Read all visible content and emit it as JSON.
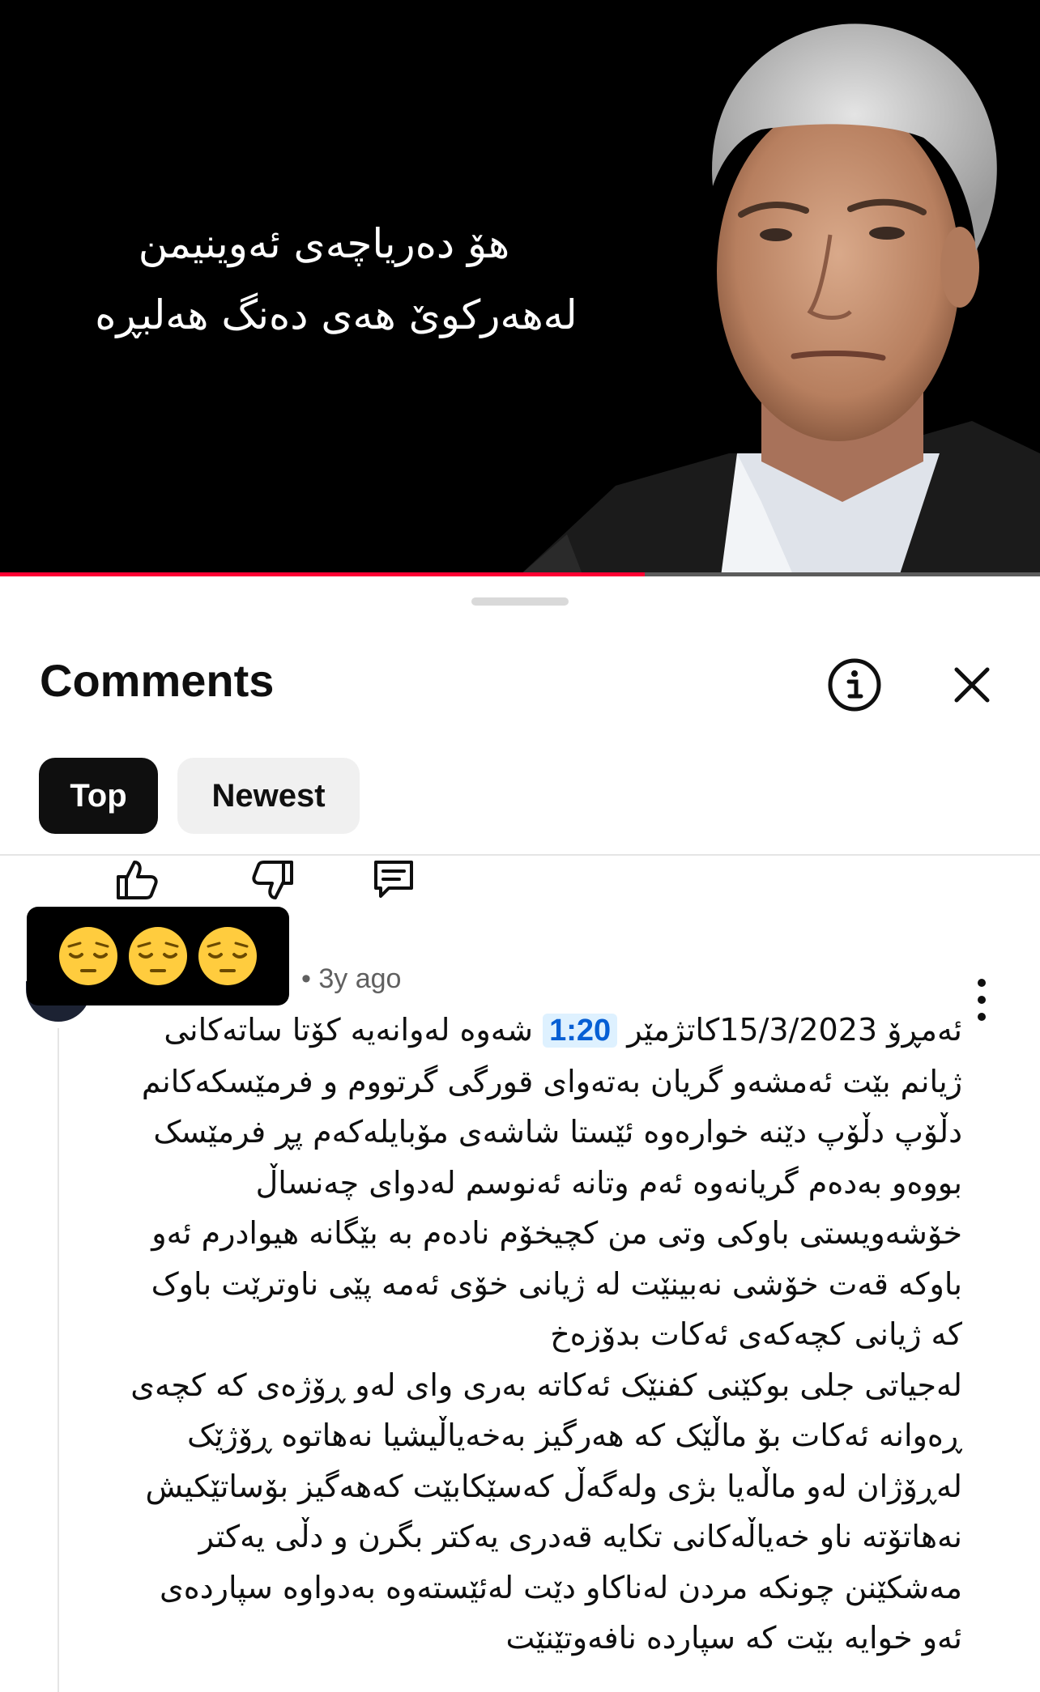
{
  "video": {
    "overlay_line1": "هۆ دەریاچەی ئەوینیمن",
    "overlay_line2": "لەهەرکوێ هەی دەنگ هەلبڕە",
    "progress_fraction": 0.62,
    "progress_color": "#ff0033"
  },
  "sheet": {
    "title": "Comments",
    "info_icon": "info-icon",
    "close_icon": "close-icon"
  },
  "filters": {
    "top": "Top",
    "newest": "Newest",
    "selected": "Top"
  },
  "actions": {
    "like_icon": "thumbs-up-icon",
    "dislike_icon": "thumbs-down-icon",
    "reply_icon": "reply-icon"
  },
  "reaction_emojis": [
    "😔",
    "😔",
    "😔"
  ],
  "comment": {
    "meta": "• 3y ago",
    "timestamp_link": "1:20",
    "line1_before": "ئەمڕۆ 15/3/2023کاتژمێر ",
    "line1_after": " شەوە لەوانەیە کۆتا ساتەکانی",
    "lines": [
      "ژیانم بێت ئەمشەو گریان بەتەوای قورگی گرتووم و فرمێسکەکانم",
      "دڵۆپ دڵۆپ دێنە خوارەوە ئێستا شاشەی مۆبایلەکەم پڕ فرمێسک",
      "بووەو بەدەم گریانەوە ئەم وتانە ئەنوسم لەدوای چەنساڵ",
      "خۆشەویستی باوکی وتی من کچیخۆم نادەم بە بێگانە هیوادرم ئەو",
      "باوکە قەت خۆشی نەبینێت لە ژیانی خۆی ئەمە پێی ناوترێت باوک",
      "کە ژیانی کچەکەی ئەکات بدۆزەخ",
      "لەجیاتی جلی بوکێنی کفنێک ئەکاتە بەری وای لەو ڕۆژەی کە کچەی",
      "ڕەوانە ئەکات بۆ ماڵێک کە هەرگیز بەخەیاڵیشیا نەهاتوە ڕۆژێک",
      "لەڕۆژان لەو ماڵەیا بژی ولەگەڵ کەسێکابێت کەهەگیز بۆساتێکیش",
      "نەهاتۆتە ناو خەیاڵەکانی تکایە قەدری یەکتر بگرن و دڵی یەکتر",
      "مەشکێنن چونکە مردن لەناکاو دێت لەئێستەوە بەدواوە سپاردەی",
      "ئەو خوایە بێت کە سپاردە نافەوتێنێت"
    ]
  }
}
